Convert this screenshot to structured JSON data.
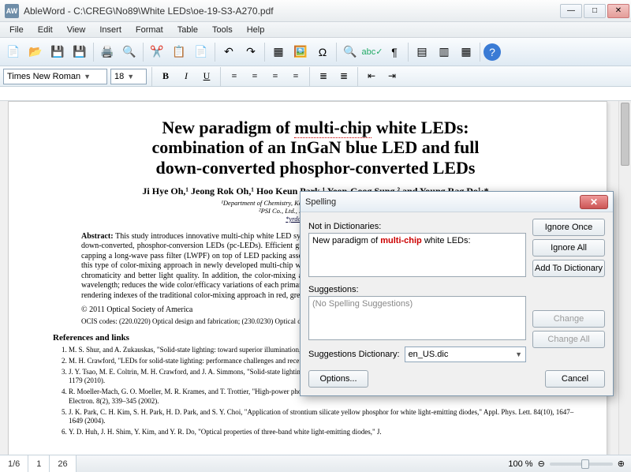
{
  "window": {
    "title": "AbleWord - C:\\CREG\\No89\\White LEDs\\oe-19-S3-A270.pdf",
    "logo": "AW"
  },
  "menu": [
    "File",
    "Edit",
    "View",
    "Insert",
    "Format",
    "Table",
    "Tools",
    "Help"
  ],
  "format": {
    "font": "Times New Roman",
    "size": "18"
  },
  "status": {
    "tabs": [
      "1/6",
      "1",
      "26"
    ],
    "zoom": "100 %"
  },
  "doc": {
    "title_l1_a": "New paradigm of ",
    "title_l1_b": "multi-chip",
    "title_l1_c": " white LEDs:",
    "title_l2": "combination of an InGaN blue LED and full",
    "title_l3": "down-converted phosphor-converted LEDs",
    "authors": "Ji Hye Oh,¹ Jeong Rok Oh,¹ Hoo Keun Park,¹ Yeon-Goog Sung,² and Young Rag Do¹·*",
    "affil1": "¹Department of Chemistry, Kookmin University, Seoul 136-702, Korea",
    "affil2": "²PSI Co., Ltd., Kyunki-Do 442-160, Korea",
    "email": "*yrdo@kookmin.ac.kr",
    "abstract_label": "Abstract:",
    "abstract": " This study introduces innovative multi-chip white LED systems that combine an InGaN blue LED and green/red or green/amber/red full down-converted, phosphor-conversion LEDs (pc-LEDs). Efficient green, amber, and red full down-converted pc-LEDs were fabricated by simply capping a long-wave pass filter (LWPF) on top of LED packing associated with each corresponding powder phosphor. The principal advantage of this type of color-mixing approach in newly developed multi-chip white LEDs based on colored pc-LEDs is thought to be dynamic control of the chromaticity and better light quality. In addition, the color-mixing approach improves the low efficacy of green/amber LEDs in the \"green gap\" wavelength; reduces the wide color/efficacy variations of each primary LED with at different temperatures and currents; and improves the low color rendering indexes of the traditional color-mixing approach in red, green, and blue (RGB) multi-chip white LEDs.",
    "copyright": "© 2011 Optical Society of America",
    "ocis": "OCIS codes: (220.0220) Optical design and fabrication; (230.0230) Optical devices; (230.1480) Bragg reflectors; (230.3670) Light-emitting diodes.",
    "refs_label": "References and links",
    "refs": [
      "M. S. Shur, and A. Zukauskas, \"Solid-state lighting: toward superior illumination,\" Proc. IEEE 93(10), 1691–1703 (2005).",
      "M. H. Crawford, \"LEDs for solid-state lighting: performance challenges and recent advances,\" IEEE J. Sel. Top. Quantum Electron. 15(4), 1028–1040 (2009).",
      "J. Y. Tsao, M. E. Coltrin, M. H. Crawford, and J. A. Simmons, \"Solid-state lighting: an integrated human factors, technology, and economic perspective,\" Proc. IEEE 98(7), 1162–1179 (2010).",
      "R. Moeller-Mach, G. O. Moeller, M. R. Krames, and T. Trottier, \"High-power phosphor-converted light-emitting diodes based on III-Nitrides,\" IEEE J. Sel. Top. Quantum Electron. 8(2), 339–345 (2002).",
      "J. K. Park, C. H. Kim, S. H. Park, H. D. Park, and S. Y. Choi, \"Application of strontium silicate yellow phosphor for white light-emitting diodes,\" Appl. Phys. Lett. 84(10), 1647–1649 (2004).",
      "Y. D. Huh, J. H. Shim, Y. Kim, and Y. R. Do, \"Optical properties of three-band white light-emitting diodes,\" J."
    ]
  },
  "spelling": {
    "title": "Spelling",
    "notInDict": "Not in Dictionaries:",
    "phrase_a": "New paradigm of ",
    "phrase_b": "multi-chip",
    "phrase_c": " white LEDs:",
    "suggestionsLabel": "Suggestions:",
    "noSuggestions": "(No Spelling Suggestions)",
    "dictLabel": "Suggestions Dictionary:",
    "dictValue": "en_US.dic",
    "btnIgnoreOnce": "Ignore Once",
    "btnIgnoreAll": "Ignore All",
    "btnAddDict": "Add To Dictionary",
    "btnChange": "Change",
    "btnChangeAll": "Change All",
    "btnOptions": "Options...",
    "btnCancel": "Cancel"
  }
}
